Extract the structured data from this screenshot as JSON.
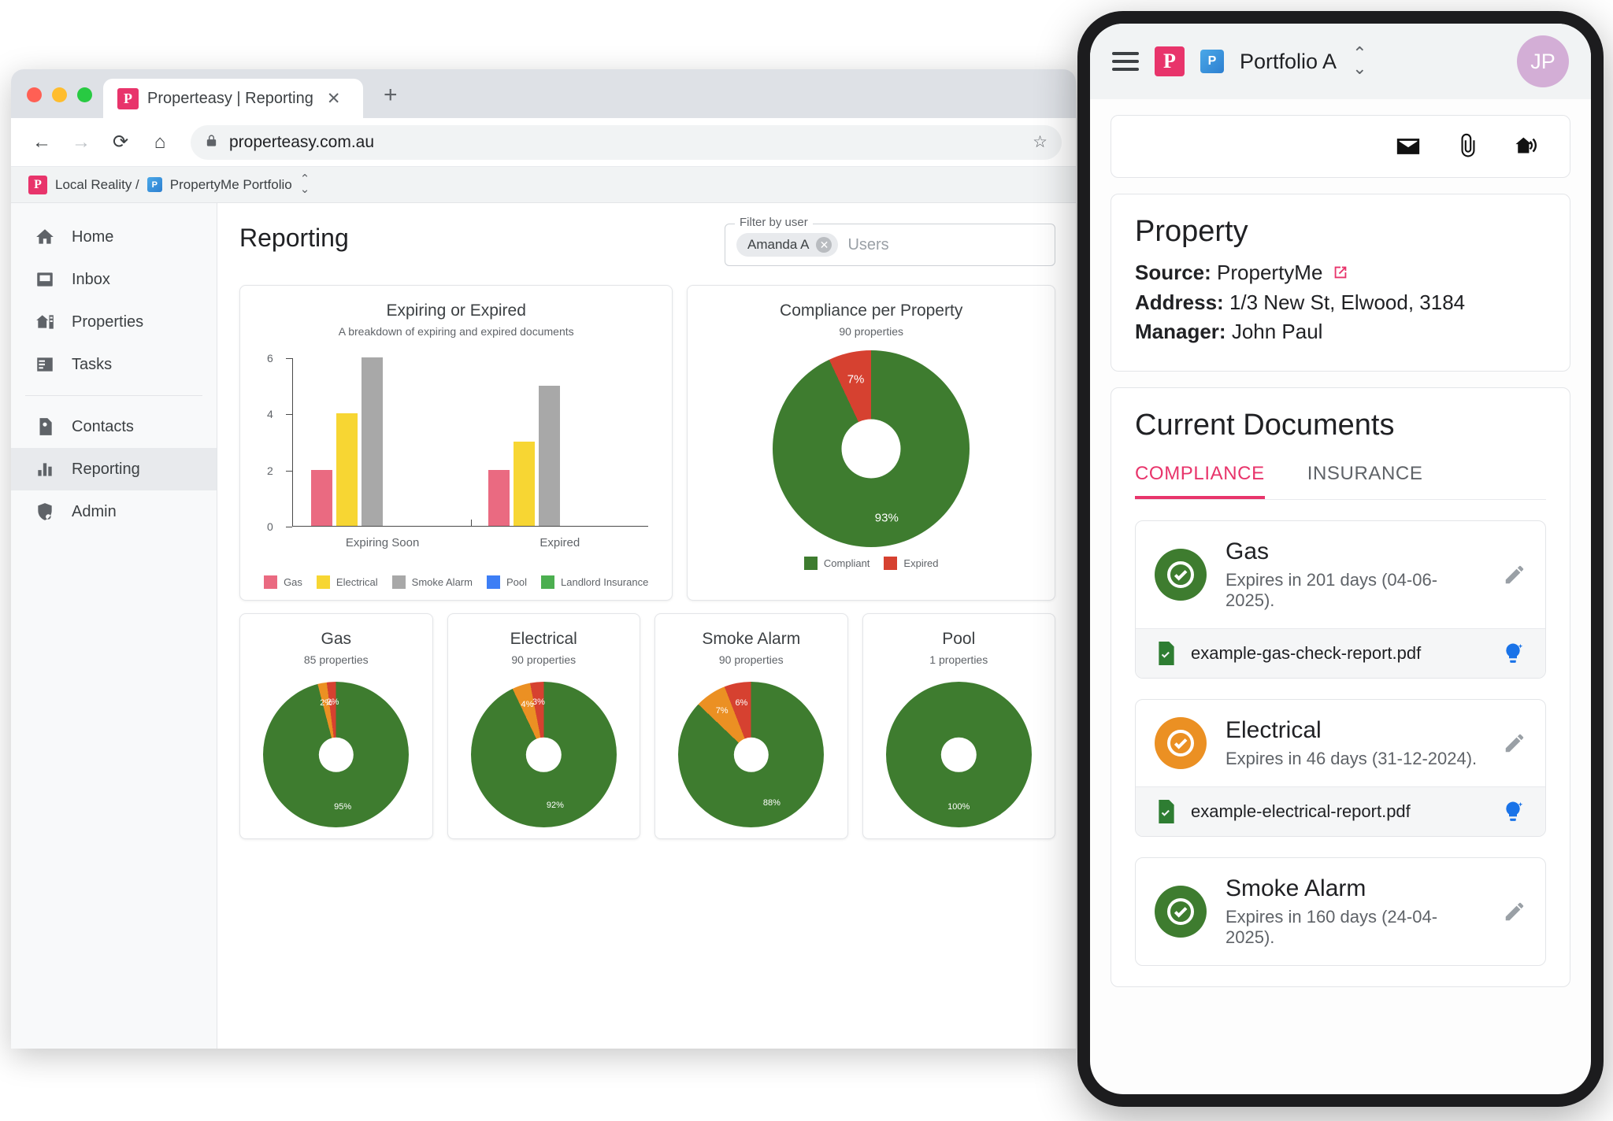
{
  "browser": {
    "tab_title": "Properteasy | Reporting",
    "new_tab_label": "+",
    "close_tab_label": "✕",
    "back_label": "←",
    "forward_label": "→",
    "reload_label": "⟳",
    "home_label": "⌂",
    "url": "properteasy.com.au",
    "lock_icon": "lock-icon",
    "star_label": "☆"
  },
  "breadcrumb": {
    "org": "Local Reality /",
    "portfolio": "PropertyMe Portfolio",
    "pm_badge": "P"
  },
  "sidebar": {
    "items": [
      {
        "label": "Home",
        "icon": "home-icon",
        "active": false
      },
      {
        "label": "Inbox",
        "icon": "inbox-icon",
        "active": false
      },
      {
        "label": "Properties",
        "icon": "properties-icon",
        "active": false
      },
      {
        "label": "Tasks",
        "icon": "tasks-icon",
        "active": false
      },
      {
        "label": "Contacts",
        "icon": "contacts-icon",
        "active": false
      },
      {
        "label": "Reporting",
        "icon": "reporting-icon",
        "active": true
      },
      {
        "label": "Admin",
        "icon": "admin-shield-icon",
        "active": false
      }
    ]
  },
  "page": {
    "title": "Reporting",
    "filter": {
      "label": "Filter by user",
      "chip": "Amanda A",
      "chip_remove": "✕",
      "placeholder": "Users"
    }
  },
  "colors": {
    "gas": "#ea6a81",
    "electrical": "#f7d633",
    "smoke_alarm": "#a8a8a8",
    "pool": "#3d7ef5",
    "landlord_insurance": "#4caf50",
    "compliant": "#3e7c2f",
    "expiring": "#eb9023",
    "expired": "#d64130",
    "accent": "#e8346b"
  },
  "chart_data": [
    {
      "type": "bar",
      "title": "Expiring or Expired",
      "subtitle": "A breakdown of expiring and expired documents",
      "categories": [
        "Expiring Soon",
        "Expired"
      ],
      "ylim": [
        0,
        6
      ],
      "yticks": [
        0,
        2,
        4,
        6
      ],
      "xlabel": "",
      "ylabel": "",
      "grid": false,
      "legend_position": "bottom",
      "series": [
        {
          "name": "Gas",
          "color": "#ea6a81",
          "values": [
            2,
            2
          ]
        },
        {
          "name": "Electrical",
          "color": "#f7d633",
          "values": [
            4,
            3
          ]
        },
        {
          "name": "Smoke Alarm",
          "color": "#a8a8a8",
          "values": [
            6,
            5
          ]
        },
        {
          "name": "Pool",
          "color": "#3d7ef5",
          "values": [
            0,
            0
          ]
        },
        {
          "name": "Landlord Insurance",
          "color": "#4caf50",
          "values": [
            0,
            0
          ]
        }
      ]
    },
    {
      "type": "pie",
      "title": "Compliance per Property",
      "subtitle": "90 properties",
      "legend_position": "bottom",
      "slices": [
        {
          "name": "Compliant",
          "value": 93,
          "label": "93%",
          "color": "#3e7c2f"
        },
        {
          "name": "Expired",
          "value": 7,
          "label": "7%",
          "color": "#d64130"
        }
      ]
    },
    {
      "type": "pie",
      "title": "Gas",
      "subtitle": "85 properties",
      "slices": [
        {
          "name": "Compliant",
          "value": 95,
          "label": "95%",
          "color": "#3e7c2f"
        },
        {
          "name": "Expiring",
          "value": 2,
          "label": "2%",
          "color": "#eb9023"
        },
        {
          "name": "Expired",
          "value": 2,
          "label": "2%",
          "color": "#d64130"
        }
      ]
    },
    {
      "type": "pie",
      "title": "Electrical",
      "subtitle": "90 properties",
      "slices": [
        {
          "name": "Compliant",
          "value": 92,
          "label": "92%",
          "color": "#3e7c2f"
        },
        {
          "name": "Expiring",
          "value": 4,
          "label": "4%",
          "color": "#eb9023"
        },
        {
          "name": "Expired",
          "value": 3,
          "label": "3%",
          "color": "#d64130"
        }
      ]
    },
    {
      "type": "pie",
      "title": "Smoke Alarm",
      "subtitle": "90 properties",
      "slices": [
        {
          "name": "Compliant",
          "value": 88,
          "label": "88%",
          "color": "#3e7c2f"
        },
        {
          "name": "Expiring",
          "value": 7,
          "label": "7%",
          "color": "#eb9023"
        },
        {
          "name": "Expired",
          "value": 6,
          "label": "6%",
          "color": "#d64130"
        }
      ]
    },
    {
      "type": "pie",
      "title": "Pool",
      "subtitle": "1 properties",
      "slices": [
        {
          "name": "Compliant",
          "value": 100,
          "label": "100%",
          "color": "#3e7c2f"
        }
      ]
    }
  ],
  "compliance_legend": [
    {
      "label": "Compliant",
      "color": "#3e7c2f"
    },
    {
      "label": "Expired",
      "color": "#d64130"
    }
  ],
  "phone": {
    "header": {
      "menu_icon": "hamburger-menu-icon",
      "logo": "P",
      "pm_badge": "P",
      "portfolio": "Portfolio A",
      "sort_icon": "sort-updown-icon",
      "avatar_initials": "JP"
    },
    "toolbar": [
      {
        "icon": "mail-icon"
      },
      {
        "icon": "paperclip-icon"
      },
      {
        "icon": "house-wifi-icon"
      }
    ],
    "property": {
      "heading": "Property",
      "source_label": "Source:",
      "source_value": "PropertyMe",
      "external_link_icon": "external-link-icon",
      "address_label": "Address:",
      "address_value": "1/3 New St, Elwood, 3184",
      "manager_label": "Manager:",
      "manager_value": "John Paul"
    },
    "documents": {
      "heading": "Current Documents",
      "tabs": [
        {
          "label": "COMPLIANCE",
          "active": true
        },
        {
          "label": "INSURANCE",
          "active": false
        }
      ],
      "items": [
        {
          "title": "Gas",
          "subtitle": "Expires in 201 days (04-06-2025).",
          "status_color": "#3e7c2f",
          "status_icon": "check-circle-icon",
          "edit_icon": "pencil-icon",
          "file": "example-gas-check-report.pdf",
          "file_icon": "pdf-check-icon",
          "ai_icon": "lightbulb-ai-icon"
        },
        {
          "title": "Electrical",
          "subtitle": "Expires in 46 days (31-12-2024).",
          "status_color": "#eb9023",
          "status_icon": "check-circle-icon",
          "edit_icon": "pencil-icon",
          "file": "example-electrical-report.pdf",
          "file_icon": "pdf-check-icon",
          "ai_icon": "lightbulb-ai-icon"
        },
        {
          "title": "Smoke Alarm",
          "subtitle": "Expires in 160 days (24-04-2025).",
          "status_color": "#3e7c2f",
          "status_icon": "check-circle-icon",
          "edit_icon": "pencil-icon",
          "file": null,
          "file_icon": null,
          "ai_icon": null
        }
      ]
    }
  }
}
